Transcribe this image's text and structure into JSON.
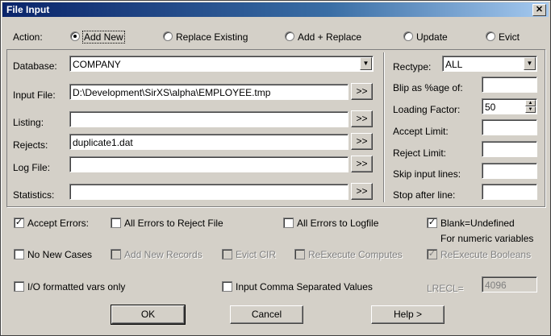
{
  "window": {
    "title": "File Input",
    "close_label": "✕"
  },
  "action": {
    "label": "Action:",
    "options": [
      {
        "label": "Add New",
        "selected": true
      },
      {
        "label": "Replace Existing",
        "selected": false
      },
      {
        "label": "Add + Replace",
        "selected": false
      },
      {
        "label": "Update",
        "selected": false
      },
      {
        "label": "Evict",
        "selected": false
      }
    ]
  },
  "left": {
    "database": {
      "label": "Database:",
      "value": "COMPANY"
    },
    "input_file": {
      "label": "Input File:",
      "value": "D:\\Development\\SirXS\\alpha\\EMPLOYEE.tmp",
      "browse": ">>"
    },
    "listing": {
      "label": "Listing:",
      "value": "",
      "browse": ">>"
    },
    "rejects": {
      "label": "Rejects:",
      "value": "duplicate1.dat",
      "browse": ">>"
    },
    "log_file": {
      "label": "Log File:",
      "value": "",
      "browse": ">>"
    },
    "statistics": {
      "label": "Statistics:",
      "value": "",
      "browse": ">>"
    }
  },
  "right": {
    "rectype": {
      "label": "Rectype:",
      "value": "ALL"
    },
    "blip": {
      "label": "Blip as %age of:",
      "value": ""
    },
    "loading_factor": {
      "label": "Loading Factor:",
      "value": "50"
    },
    "accept_limit": {
      "label": "Accept Limit:",
      "value": ""
    },
    "reject_limit": {
      "label": "Reject Limit:",
      "value": ""
    },
    "skip_input_lines": {
      "label": "Skip input lines:",
      "value": ""
    },
    "stop_after_line": {
      "label": "Stop after line:",
      "value": ""
    }
  },
  "options": {
    "accept_errors": {
      "label": "Accept Errors:",
      "checked": true
    },
    "all_errors_reject": {
      "label": "All Errors to Reject File",
      "checked": false
    },
    "all_errors_log": {
      "label": "All Errors to Logfile",
      "checked": false
    },
    "blank_undefined": {
      "label": "Blank=Undefined",
      "checked": true,
      "note": "For numeric variables"
    },
    "no_new_cases": {
      "label": "No New Cases",
      "checked": false
    },
    "add_new_records": {
      "label": "Add New Records",
      "checked": false,
      "disabled": true
    },
    "evict_cir": {
      "label": "Evict CIR",
      "checked": false,
      "disabled": true
    },
    "reexecute_computes": {
      "label": "ReExecute Computes",
      "checked": false,
      "disabled": true
    },
    "reexecute_booleans": {
      "label": "ReExecute Booleans",
      "checked": true,
      "disabled": true
    },
    "io_formatted": {
      "label": "I/O formatted vars only",
      "checked": false
    },
    "comma_separated": {
      "label": "Input Comma Separated Values",
      "checked": false
    },
    "lrecl": {
      "label": "LRECL=",
      "value": "4096"
    }
  },
  "buttons": {
    "ok": "OK",
    "cancel": "Cancel",
    "help": "Help >"
  }
}
